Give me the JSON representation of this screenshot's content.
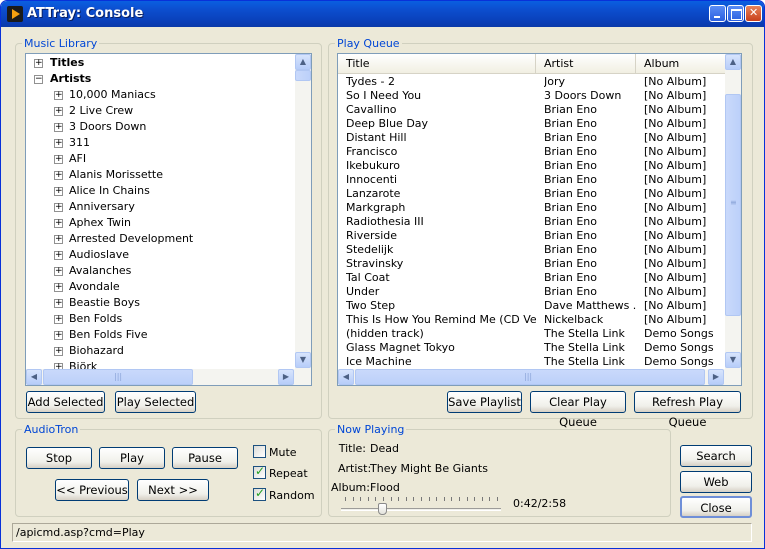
{
  "window": {
    "title": "ATTray: Console"
  },
  "library": {
    "legend": "Music Library",
    "nodes": [
      {
        "label": "Titles",
        "level": 0,
        "sign": "+",
        "bold": true
      },
      {
        "label": "Artists",
        "level": 0,
        "sign": "−",
        "bold": true
      },
      {
        "label": "10,000 Maniacs",
        "level": 1,
        "sign": "+"
      },
      {
        "label": "2 Live Crew",
        "level": 1,
        "sign": "+"
      },
      {
        "label": "3 Doors Down",
        "level": 1,
        "sign": "+"
      },
      {
        "label": "311",
        "level": 1,
        "sign": "+"
      },
      {
        "label": "AFI",
        "level": 1,
        "sign": "+"
      },
      {
        "label": "Alanis Morissette",
        "level": 1,
        "sign": "+"
      },
      {
        "label": "Alice In Chains",
        "level": 1,
        "sign": "+"
      },
      {
        "label": "Anniversary",
        "level": 1,
        "sign": "+"
      },
      {
        "label": "Aphex Twin",
        "level": 1,
        "sign": "+"
      },
      {
        "label": "Arrested Development",
        "level": 1,
        "sign": "+"
      },
      {
        "label": "Audioslave",
        "level": 1,
        "sign": "+"
      },
      {
        "label": "Avalanches",
        "level": 1,
        "sign": "+"
      },
      {
        "label": "Avondale",
        "level": 1,
        "sign": "+"
      },
      {
        "label": "Beastie Boys",
        "level": 1,
        "sign": "+"
      },
      {
        "label": "Ben Folds",
        "level": 1,
        "sign": "+"
      },
      {
        "label": "Ben Folds Five",
        "level": 1,
        "sign": "+"
      },
      {
        "label": "Biohazard",
        "level": 1,
        "sign": "+"
      },
      {
        "label": "Björk",
        "level": 1,
        "sign": "+"
      }
    ],
    "add_selected": "Add Selected",
    "play_selected": "Play Selected"
  },
  "queue": {
    "legend": "Play Queue",
    "columns": [
      "Title",
      "Artist",
      "Album"
    ],
    "rows": [
      [
        "Tydes - 2",
        "Jory",
        "[No Album]"
      ],
      [
        "So I Need You",
        "3 Doors Down",
        "[No Album]"
      ],
      [
        "Cavallino",
        "Brian Eno",
        "[No Album]"
      ],
      [
        "Deep Blue Day",
        "Brian Eno",
        "[No Album]"
      ],
      [
        "Distant Hill",
        "Brian Eno",
        "[No Album]"
      ],
      [
        "Francisco",
        "Brian Eno",
        "[No Album]"
      ],
      [
        "Ikebukuro",
        "Brian Eno",
        "[No Album]"
      ],
      [
        "Innocenti",
        "Brian Eno",
        "[No Album]"
      ],
      [
        "Lanzarote",
        "Brian Eno",
        "[No Album]"
      ],
      [
        "Markgraph",
        "Brian Eno",
        "[No Album]"
      ],
      [
        "Radiothesia III",
        "Brian Eno",
        "[No Album]"
      ],
      [
        "Riverside",
        "Brian Eno",
        "[No Album]"
      ],
      [
        "Stedelijk",
        "Brian Eno",
        "[No Album]"
      ],
      [
        "Stravinsky",
        "Brian Eno",
        "[No Album]"
      ],
      [
        "Tal Coat",
        "Brian Eno",
        "[No Album]"
      ],
      [
        "Under",
        "Brian Eno",
        "[No Album]"
      ],
      [
        "Two Step",
        "Dave Matthews ...",
        "[No Album]"
      ],
      [
        "This Is How You Remind Me (CD Versi...",
        "Nickelback",
        "[No Album]"
      ],
      [
        "(hidden track)",
        "The Stella Link",
        "Demo Songs"
      ],
      [
        "Glass Magnet Tokyo",
        "The Stella Link",
        "Demo Songs"
      ],
      [
        "Ice Machine",
        "The Stella Link",
        "Demo Songs"
      ]
    ],
    "save_playlist": "Save Playlist",
    "clear_queue": "Clear Play Queue",
    "refresh_queue": "Refresh Play Queue"
  },
  "audiotron": {
    "legend": "AudioTron",
    "stop": "Stop",
    "play": "Play",
    "pause": "Pause",
    "previous": "<< Previous",
    "next": "Next >>",
    "mute_label": "Mute",
    "repeat_label": "Repeat",
    "random_label": "Random",
    "mute": false,
    "repeat": true,
    "random": true
  },
  "now_playing": {
    "legend": "Now Playing",
    "title_label": "Title:",
    "title": "Dead",
    "artist_label": "Artist:",
    "artist": "They Might Be Giants",
    "album_label": "Album:",
    "album": "Flood",
    "time": "0:42/2:58",
    "progress": 0.236
  },
  "side_buttons": {
    "search": "Search",
    "web_console": "Web Console",
    "close": "Close"
  },
  "status": {
    "text": "/apicmd.asp?cmd=Play"
  }
}
